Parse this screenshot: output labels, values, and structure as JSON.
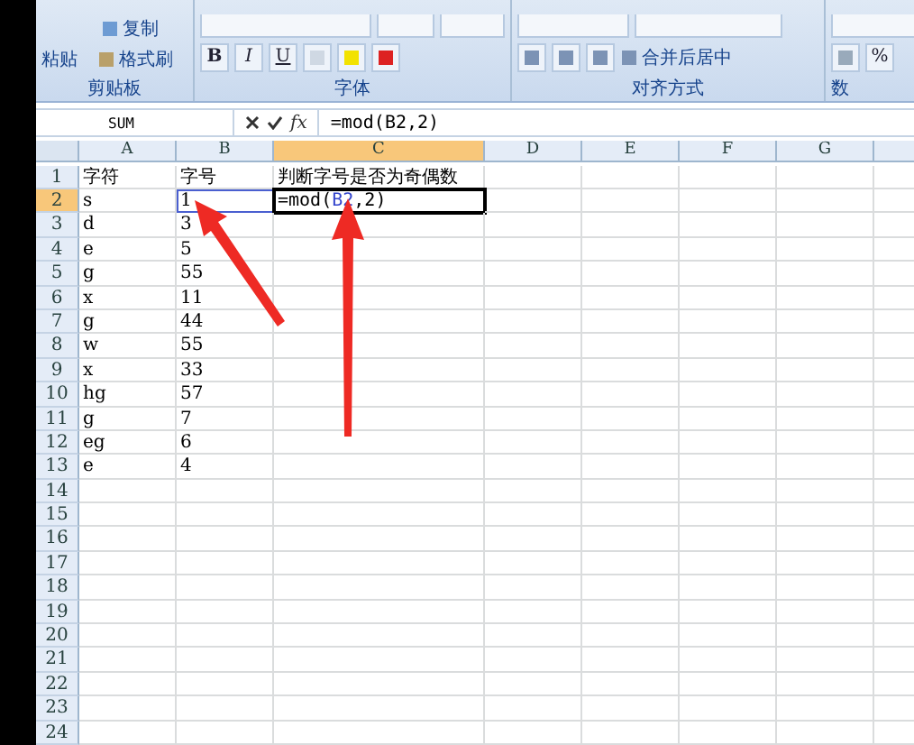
{
  "ribbon": {
    "clipboard": {
      "paste": "粘贴",
      "copy": "复制",
      "format_painter": "格式刷",
      "label": "剪贴板"
    },
    "font": {
      "buttons": [
        "B",
        "I",
        "U"
      ],
      "label": "字体"
    },
    "alignment": {
      "merge": "合并后居中",
      "label": "对齐方式"
    },
    "number": {
      "percent": "%",
      "label": "数"
    }
  },
  "formula_bar": {
    "name_box": "SUM",
    "fx": "fx",
    "formula": "=mod(B2,2)"
  },
  "columns": [
    "A",
    "B",
    "C",
    "D",
    "E",
    "F",
    "G"
  ],
  "rows": [
    {
      "number": "1",
      "cells": [
        "字符",
        "字号",
        "判断字号是否为奇偶数"
      ]
    },
    {
      "number": "2",
      "cells": [
        "s",
        "1"
      ],
      "selected": true,
      "editing": {
        "prefix": "=mod(",
        "ref": "B2",
        "suffix": ",2)"
      }
    },
    {
      "number": "3",
      "cells": [
        "d",
        "3"
      ]
    },
    {
      "number": "4",
      "cells": [
        "e",
        "5"
      ]
    },
    {
      "number": "5",
      "cells": [
        "g",
        "55"
      ]
    },
    {
      "number": "6",
      "cells": [
        "x",
        "11"
      ]
    },
    {
      "number": "7",
      "cells": [
        "g",
        "44"
      ]
    },
    {
      "number": "8",
      "cells": [
        "w",
        "55"
      ]
    },
    {
      "number": "9",
      "cells": [
        "x",
        "33"
      ]
    },
    {
      "number": "10",
      "cells": [
        "hg",
        "57"
      ]
    },
    {
      "number": "11",
      "cells": [
        "g",
        "7"
      ]
    },
    {
      "number": "12",
      "cells": [
        "eg",
        "6"
      ]
    },
    {
      "number": "13",
      "cells": [
        "e",
        "4"
      ]
    },
    {
      "number": "14",
      "cells": []
    },
    {
      "number": "15",
      "cells": []
    },
    {
      "number": "16",
      "cells": []
    },
    {
      "number": "17",
      "cells": []
    },
    {
      "number": "18",
      "cells": []
    },
    {
      "number": "19",
      "cells": []
    },
    {
      "number": "20",
      "cells": []
    },
    {
      "number": "21",
      "cells": []
    },
    {
      "number": "22",
      "cells": []
    },
    {
      "number": "23",
      "cells": []
    },
    {
      "number": "24",
      "cells": []
    }
  ]
}
